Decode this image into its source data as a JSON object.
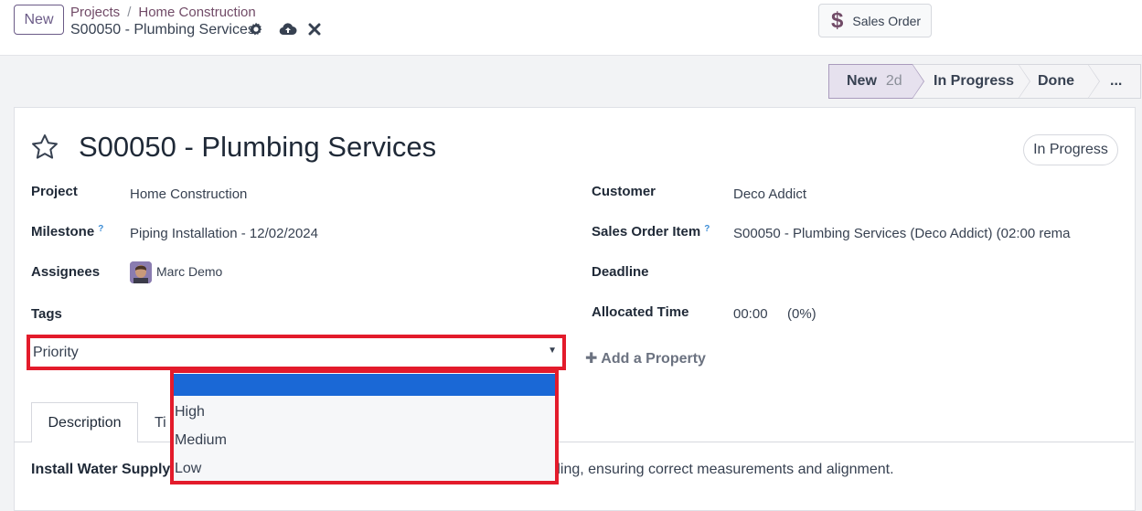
{
  "header": {
    "new_label": "New",
    "breadcrumb": [
      "Projects",
      "Home Construction"
    ],
    "record_name": "S00050 - Plumbing Services",
    "sales_order_label": "Sales Order",
    "sales_order_icon": "dollar-icon"
  },
  "statusbar": {
    "stages": [
      {
        "label": "New",
        "tag": "2d",
        "active": true
      },
      {
        "label": "In Progress",
        "active": false
      },
      {
        "label": "Done",
        "active": false
      },
      {
        "label": "...",
        "active": false
      }
    ]
  },
  "form": {
    "title": "S00050 - Plumbing Services",
    "state_badge": "In Progress",
    "left_fields": {
      "project_label": "Project",
      "project_value": "Home Construction",
      "milestone_label": "Milestone",
      "milestone_help": "?",
      "milestone_value": "Piping Installation - 12/02/2024",
      "assignees_label": "Assignees",
      "assignees_value": "Marc Demo",
      "tags_label": "Tags"
    },
    "right_fields": {
      "customer_label": "Customer",
      "customer_value": "Deco Addict",
      "so_item_label": "Sales Order Item",
      "so_item_help": "?",
      "so_item_value": "S00050 - Plumbing Services (Deco Addict) (02:00 rema",
      "deadline_label": "Deadline",
      "allocated_label": "Allocated Time",
      "allocated_value": "00:00",
      "allocated_pct": "(0%)"
    },
    "priority": {
      "value": "Priority",
      "options": [
        "",
        "High",
        "Medium",
        "Low"
      ]
    },
    "add_property_label": "Add a Property"
  },
  "tabs": [
    "Description",
    "Ti"
  ],
  "description": {
    "bold_part": "Install Water Supply",
    "rest": "ding, ensuring correct measurements and alignment."
  },
  "colors": {
    "accent": "#714b67",
    "highlight_red": "#e31b2b",
    "selected_blue": "#1a68d6"
  }
}
